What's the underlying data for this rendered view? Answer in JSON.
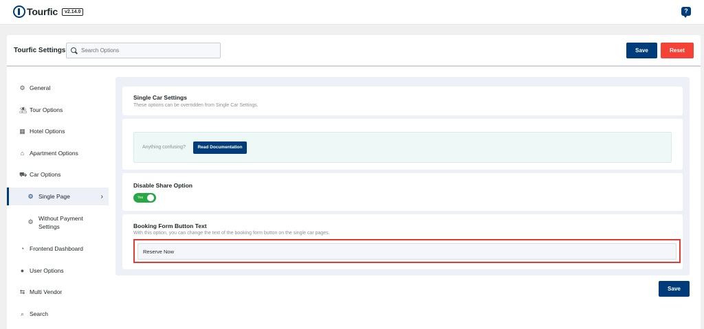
{
  "topbar": {
    "brand": "Tourfic",
    "version": "v2.14.0",
    "help_icon": "?"
  },
  "header": {
    "title": "Tourfic Settings",
    "search_placeholder": "Search Options",
    "save_label": "Save",
    "reset_label": "Reset"
  },
  "sidebar": {
    "items": [
      {
        "label": "General",
        "icon": "gear-icon"
      },
      {
        "label": "Tour Options",
        "icon": "beach-umbrella-icon"
      },
      {
        "label": "Hotel Options",
        "icon": "building-icon"
      },
      {
        "label": "Apartment Options",
        "icon": "home-icon"
      },
      {
        "label": "Car Options",
        "icon": "car-icon"
      },
      {
        "label": "Single Page",
        "icon": "gear-icon",
        "active": true
      },
      {
        "label": "Without Payment Settings",
        "icon": "gear-icon"
      },
      {
        "label": "Frontend Dashboard",
        "icon": "dashboard-icon"
      },
      {
        "label": "User Options",
        "icon": "user-icon"
      },
      {
        "label": "Multi Vendor",
        "icon": "handshake-icon"
      },
      {
        "label": "Search",
        "icon": "search-icon"
      }
    ]
  },
  "content": {
    "section_title": "Single Car Settings",
    "section_desc": "These options can be overridden from Single Car Settings.",
    "doc_text": "Anything confusing?",
    "doc_button": "Read Documentation",
    "share_title": "Disable Share Option",
    "share_toggle_text": "Yes",
    "booking_title": "Booking Form Button Text",
    "booking_desc": "With this option, you can change the text of the booking form button on the single car pages.",
    "booking_value": "Reserve Now"
  },
  "footer": {
    "save_label": "Save"
  },
  "colors": {
    "primary": "#003c79",
    "reset": "#f44336",
    "toggle_on": "#28a745",
    "highlight": "#e53935"
  }
}
